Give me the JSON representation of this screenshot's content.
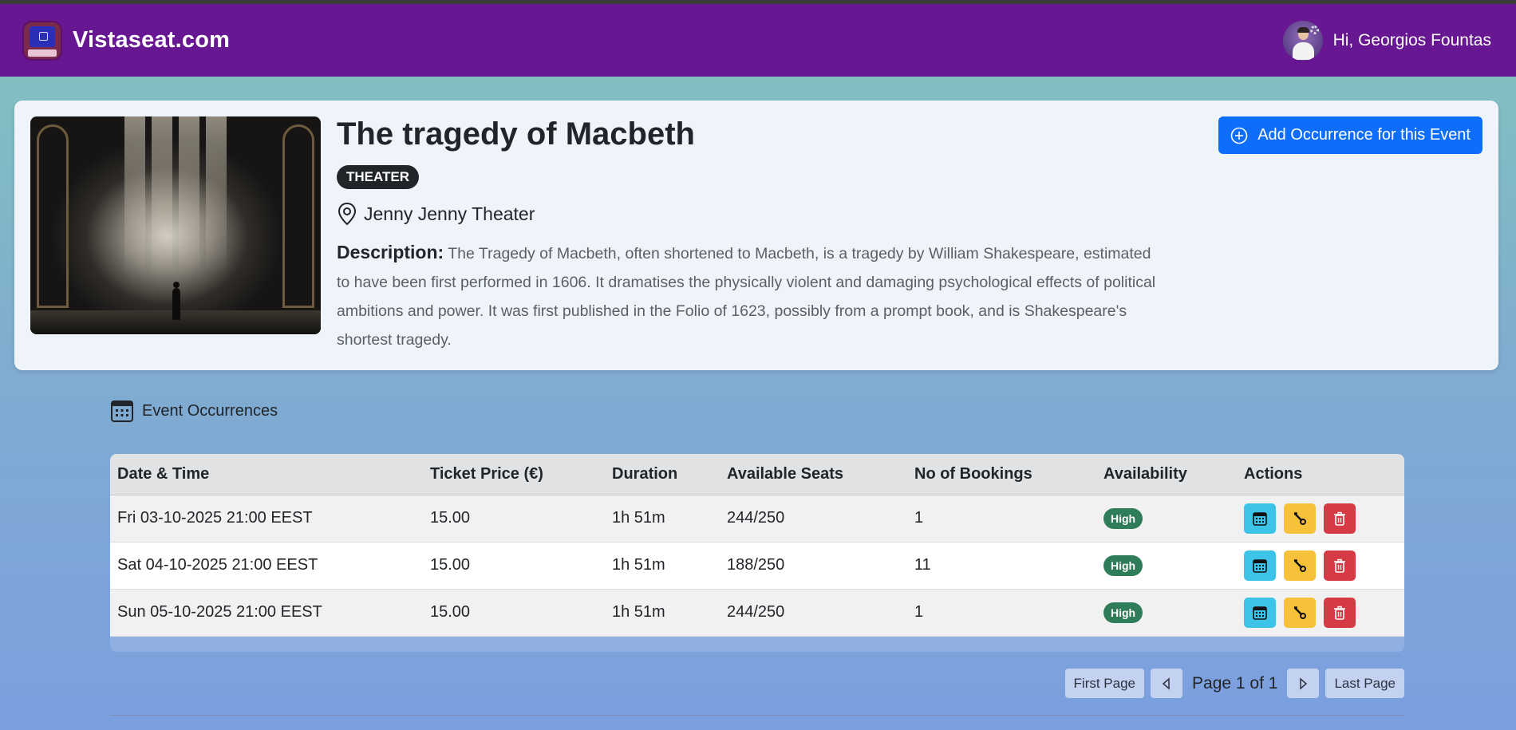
{
  "brand": {
    "name": "Vistaseat.com"
  },
  "user": {
    "greeting": "Hi, Georgios Fountas"
  },
  "event": {
    "title": "The tragedy of Macbeth",
    "category": "THEATER",
    "venue": "Jenny Jenny Theater",
    "description_label": "Description:",
    "description_text": "The Tragedy of Macbeth, often shortened to Macbeth, is a tragedy by William Shakespeare, estimated to have been first performed in 1606. It dramatises the physically violent and damaging psychological effects of political ambitions and power. It was first published in the Folio of 1623, possibly from a prompt book, and is Shakespeare's shortest tragedy.",
    "add_occurrence_label": "Add Occurrence for this Event"
  },
  "occurrences": {
    "section_title": "Event Occurrences",
    "columns": [
      "Date & Time",
      "Ticket Price (€)",
      "Duration",
      "Available Seats",
      "No of Bookings",
      "Availability",
      "Actions"
    ],
    "rows": [
      {
        "datetime": "Fri 03-10-2025 21:00 EEST",
        "price": "15.00",
        "duration": "1h 51m",
        "seats": "244/250",
        "bookings": "1",
        "availability": "High"
      },
      {
        "datetime": "Sat 04-10-2025 21:00 EEST",
        "price": "15.00",
        "duration": "1h 51m",
        "seats": "188/250",
        "bookings": "11",
        "availability": "High"
      },
      {
        "datetime": "Sun 05-10-2025 21:00 EEST",
        "price": "15.00",
        "duration": "1h 51m",
        "seats": "244/250",
        "bookings": "1",
        "availability": "High"
      }
    ]
  },
  "pagination": {
    "first_label": "First Page",
    "page_info": "Page 1 of 1",
    "last_label": "Last Page"
  },
  "colors": {
    "navbar": "#661791",
    "primary": "#0d6efd",
    "badge_dark": "#212529",
    "availability_high": "#2f7d58",
    "action_info": "#3ec3e8",
    "action_warning": "#f7c23a",
    "action_danger": "#d63a44"
  },
  "icons": {
    "logo": "vistaseat-logo-icon",
    "venue": "map-pin-icon",
    "add": "plus-circle-icon",
    "section": "calendar-grid-icon",
    "row_actions": [
      "calendar-icon",
      "wrench-icon",
      "trash-icon"
    ],
    "pager": [
      "chevron-left-icon",
      "chevron-right-icon"
    ]
  }
}
